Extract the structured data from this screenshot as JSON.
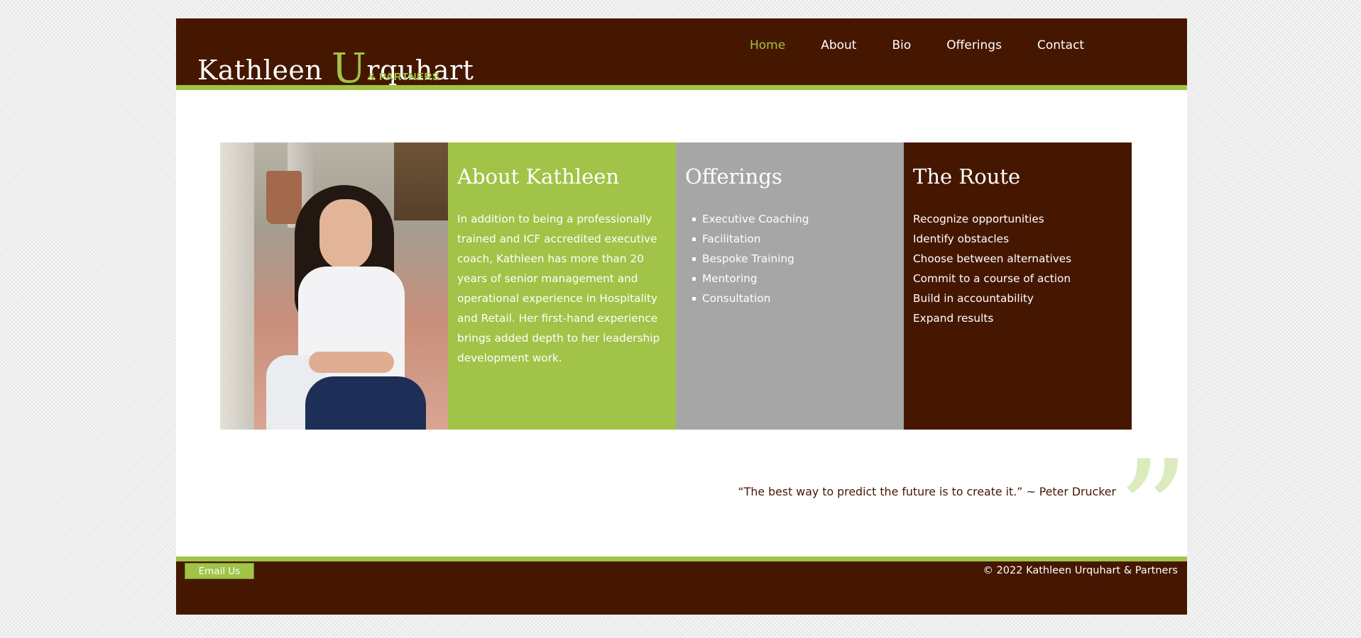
{
  "header": {
    "logo_first": "Kathleen",
    "logo_initial": "U",
    "logo_last": "rquhart",
    "logo_tagline": "& PARTNERS"
  },
  "nav": {
    "items": [
      {
        "label": "Home",
        "active": true
      },
      {
        "label": "About",
        "active": false
      },
      {
        "label": "Bio",
        "active": false
      },
      {
        "label": "Offerings",
        "active": false
      },
      {
        "label": "Contact",
        "active": false
      }
    ]
  },
  "about": {
    "title": "About Kathleen",
    "body": "In addition to being a professionally trained and ICF accredited executive coach, Kathleen has more than 20 years of senior management and operational experience in Hospitality and Retail. Her first-hand experience brings added depth to her leadership development work."
  },
  "offerings": {
    "title": "Offerings",
    "items": [
      "Executive Coaching",
      "Facilitation",
      "Bespoke Training",
      "Mentoring",
      "Consultation"
    ]
  },
  "route": {
    "title": "The Route",
    "items": [
      "Recognize opportunities",
      "Identify obstacles",
      "Choose between alternatives",
      "Commit to a course of action",
      "Build in accountability",
      "Expand results"
    ]
  },
  "quote": {
    "text": "“The best way to predict the future is to create it.” ~ Peter Drucker",
    "mark": "”"
  },
  "footer": {
    "email_label": "Email Us",
    "copyright": "© 2022 Kathleen Urquhart & Partners"
  },
  "colors": {
    "brand_brown": "#461700",
    "brand_green": "#a1c347",
    "panel_grey": "#a6a6a6"
  }
}
